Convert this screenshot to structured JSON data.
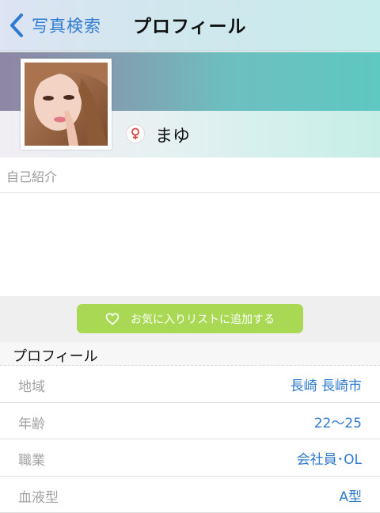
{
  "nav": {
    "back_label": "写真検索",
    "title": "プロフィール"
  },
  "profile": {
    "name": "まゆ",
    "gender_icon": "female-symbol-icon"
  },
  "intro": {
    "label": "自己紹介"
  },
  "favorite": {
    "label": "お気に入りリストに追加する",
    "icon": "heart-outline-icon"
  },
  "section": {
    "title": "プロフィール"
  },
  "details": [
    {
      "label": "地域",
      "value": "長崎 長崎市"
    },
    {
      "label": "年齢",
      "value": "22〜25"
    },
    {
      "label": "職業",
      "value": "会社員･OL"
    },
    {
      "label": "血液型",
      "value": "A型"
    }
  ],
  "colors": {
    "accent_blue": "#2f7ad1",
    "favorite_green": "#a9d854",
    "gender_red": "#d8453c"
  }
}
